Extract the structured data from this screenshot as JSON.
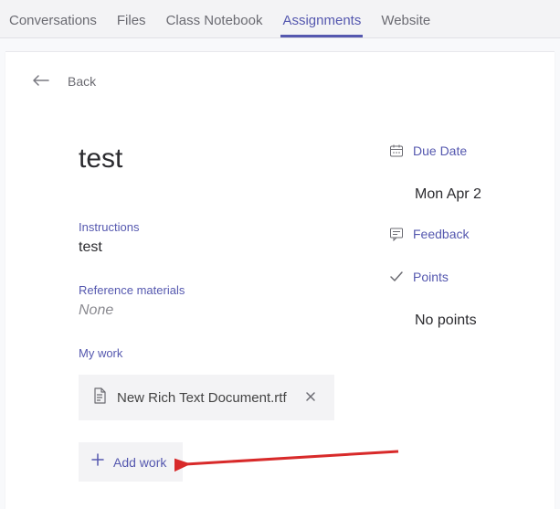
{
  "tabs": {
    "conversations": "Conversations",
    "files": "Files",
    "notebook": "Class Notebook",
    "assignments": "Assignments",
    "website": "Website"
  },
  "back": {
    "label": "Back"
  },
  "assignment": {
    "title": "test",
    "instructions_label": "Instructions",
    "instructions_value": "test",
    "reference_label": "Reference materials",
    "reference_value": "None",
    "mywork_label": "My work",
    "file_name": "New Rich Text Document.rtf",
    "add_work_label": "Add work"
  },
  "meta": {
    "due_label": "Due Date",
    "due_value": "Mon Apr 2",
    "feedback_label": "Feedback",
    "points_label": "Points",
    "points_value": "No points"
  }
}
